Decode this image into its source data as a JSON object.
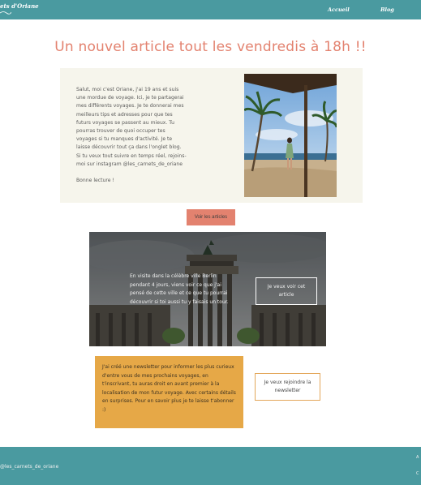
{
  "header": {
    "logo_text": "Les carnets d'Oriane",
    "nav": [
      "Accueil",
      "Blog"
    ]
  },
  "headline": "Un nouvel article tout les vendredis à 18h !!",
  "intro": {
    "paragraph": "Salut, moi c'est Oriane, j'ai 19 ans et suis\nune mordue de voyage. Ici, je te partagerai\nmes différents voyages. Je te donnerai mes\nmeilleurs tips et adresses pour que tes\nfuturs voyages se passent au mieux. Tu\npourras trouver de quoi occuper tes\nvoyages si tu manques d'activité. Je te\nlaisse découvrir tout ça dans l'onglet blog.\nSi tu veux tout suivre en temps réel, rejoins-\nmoi sur instagram @les_carnets_de_oriane",
    "closing": "Bonne lecture !"
  },
  "buttons": {
    "articles": "Voir les articles",
    "article": "Je veux voir cet article",
    "newsletter": "Je veux rejoindre la newsletter"
  },
  "berlin": {
    "text": "En visite dans la célèbre ville Berlin pendant 4 jours, viens voir ce que j'ai pensé de cette ville et ce que tu pourrai découvrir si toi aussi tu y faisais un tour."
  },
  "newsletter": {
    "text": "J'ai créé une newsletter pour informer les plus curieux d'entre vous de mes prochains voyages, en t'inscrivant, tu auras droit en avant premier à la localisation de mon futur voyage. Avec certains détails en surprises. Pour en savoir plus je te laisse t'abonner :)"
  },
  "footer": {
    "handle": "@les_carnets_de_oriane",
    "right_marks": [
      "A",
      "C"
    ]
  },
  "colors": {
    "teal": "#4a9aa0",
    "coral": "#e3826f",
    "mustard": "#e6a847",
    "cream": "#f6f5ec"
  }
}
